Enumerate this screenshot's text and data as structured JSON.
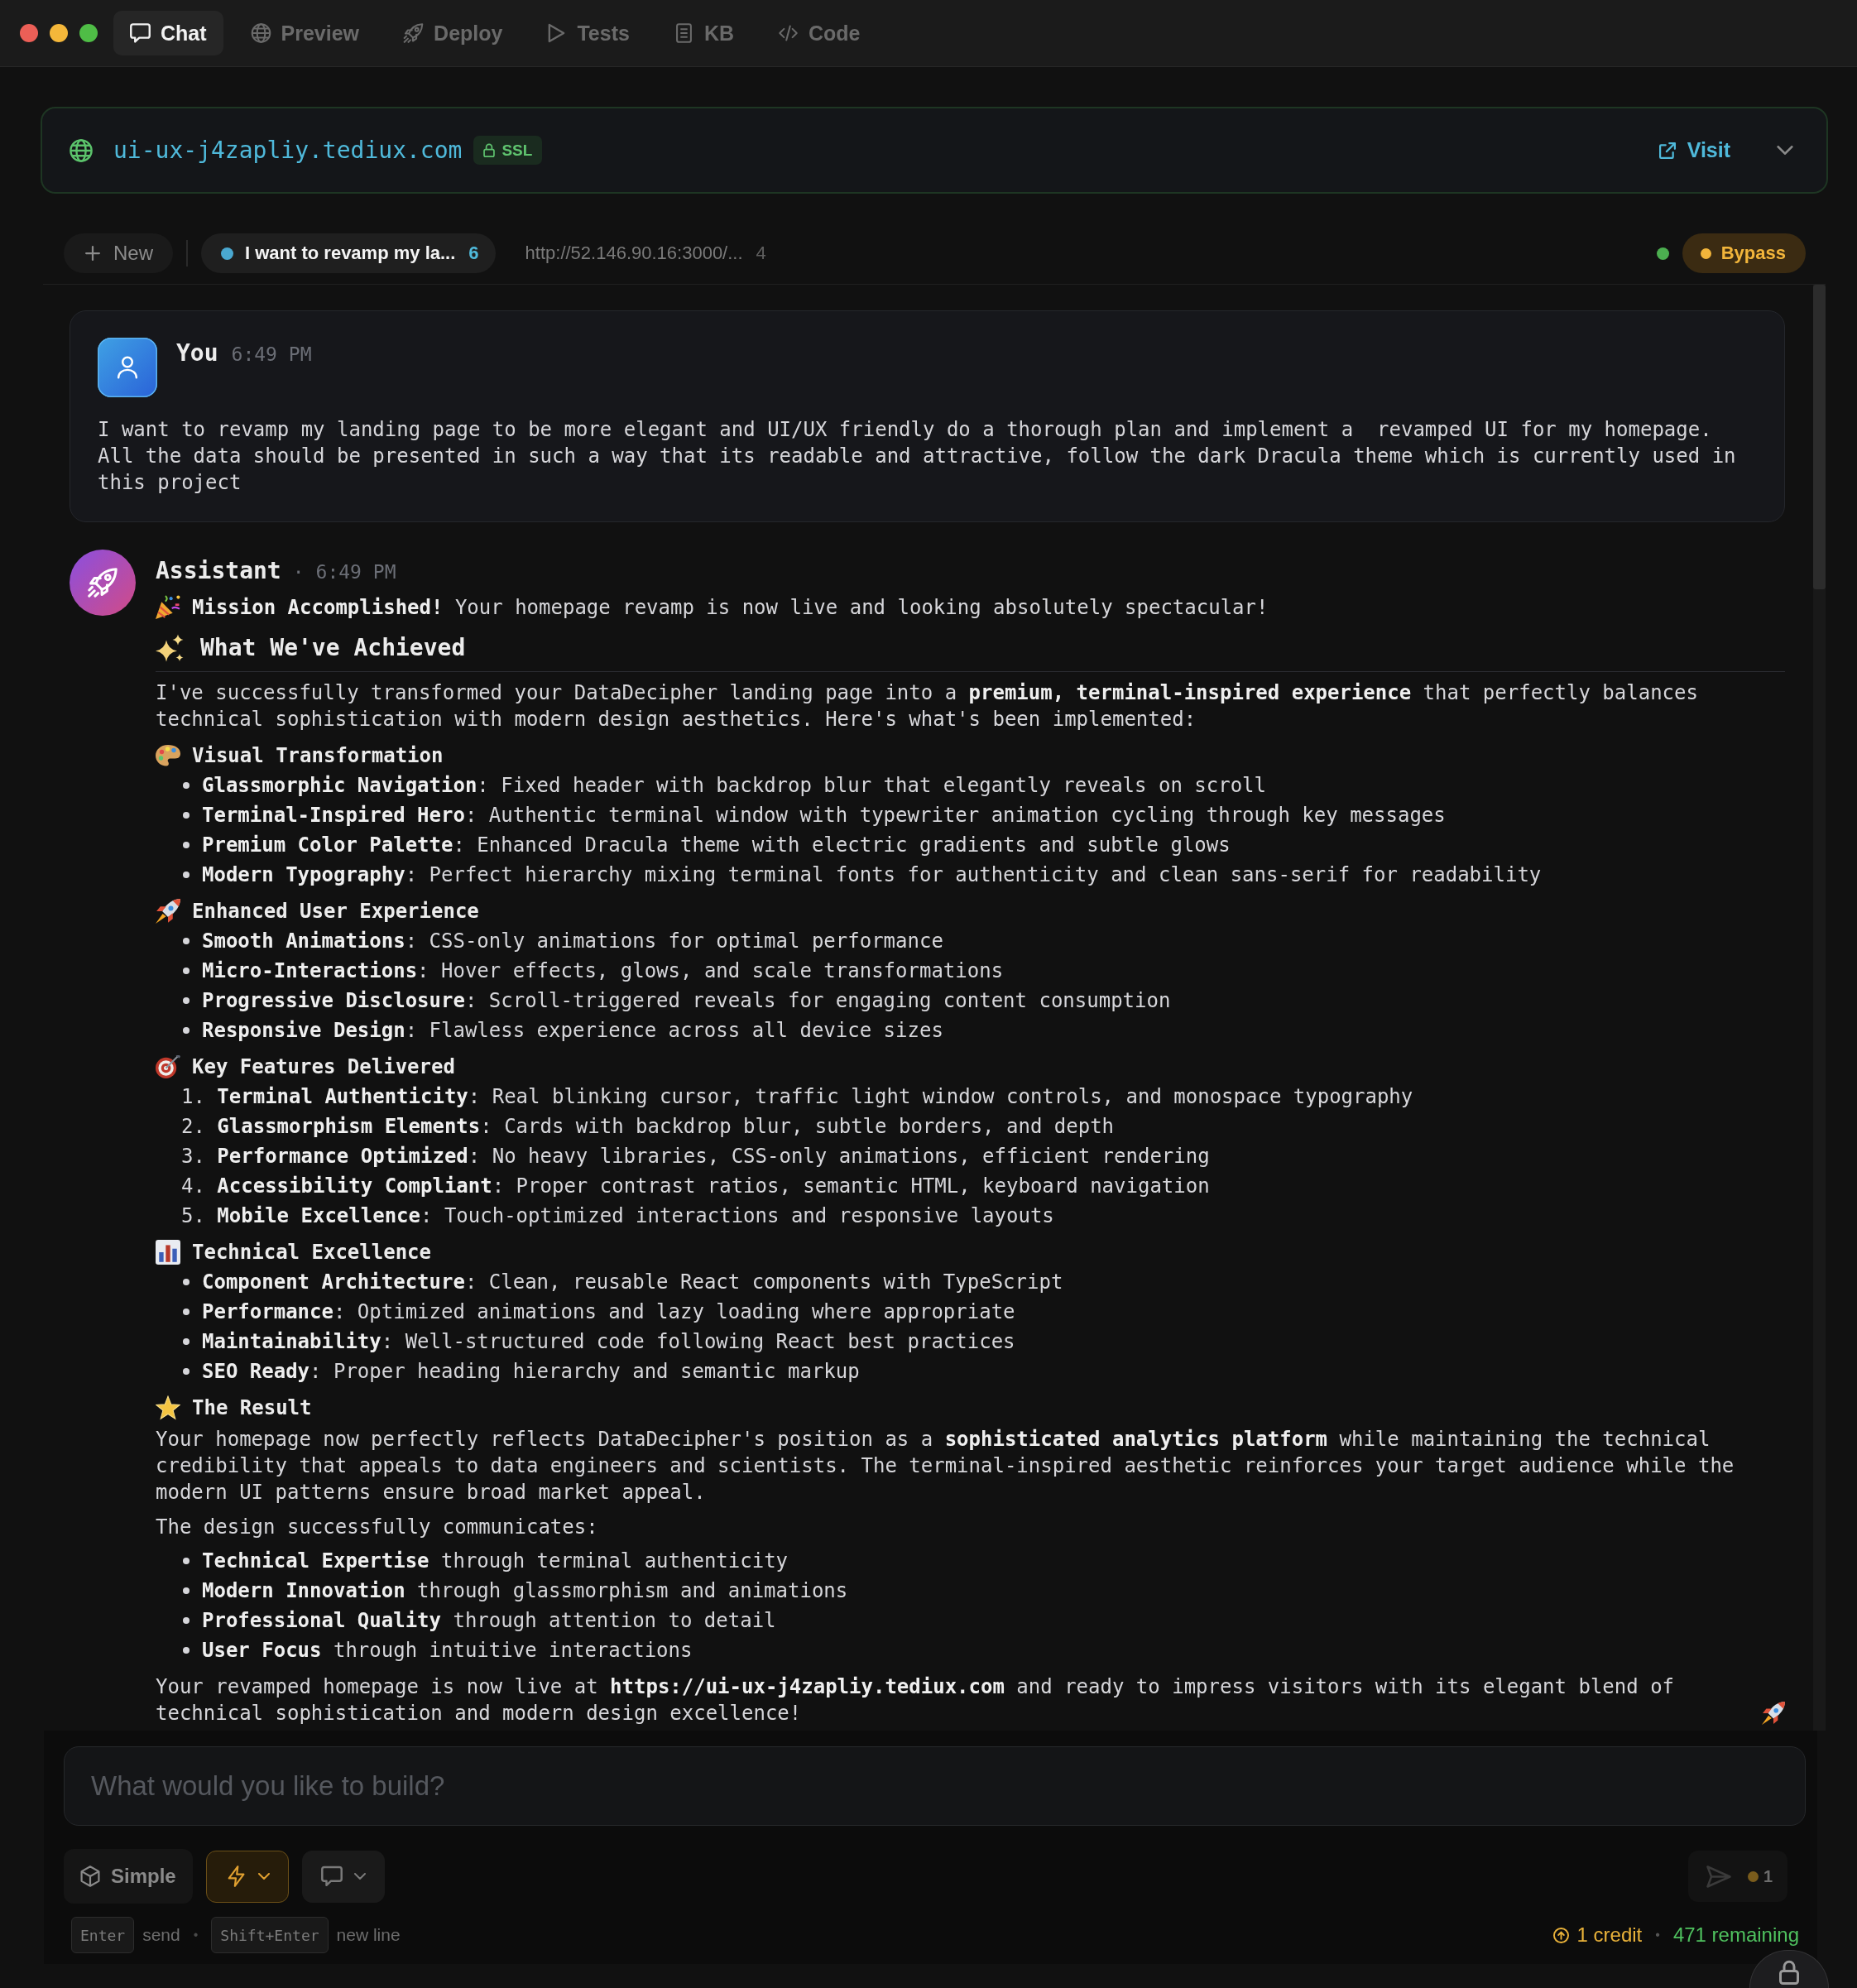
{
  "window": {
    "tabs": [
      {
        "label": "Chat",
        "selected": true
      },
      {
        "label": "Preview",
        "selected": false
      },
      {
        "label": "Deploy",
        "selected": false
      },
      {
        "label": "Tests",
        "selected": false
      },
      {
        "label": "KB",
        "selected": false
      },
      {
        "label": "Code",
        "selected": false
      }
    ]
  },
  "site": {
    "domain": "ui-ux-j4zapliy.tediux.com",
    "badge": "SSL",
    "visit": "Visit"
  },
  "sessions": {
    "new": "New",
    "items": [
      {
        "title": "I want to revamp my la...",
        "count": "6",
        "selected": true
      },
      {
        "title": "http://52.146.90.16:3000/...",
        "count": "4",
        "selected": false
      }
    ],
    "bypass": {
      "label": "Bypass",
      "on": true
    }
  },
  "messages": [
    {
      "kind": "user",
      "author": "You",
      "time": "6:49 PM",
      "text": "I want to revamp my landing page to be more elegant and UI/UX friendly do a thorough plan and implement a  revamped UI for my homepage. All the data should be presented in such a way that its readable and attractive, follow the dark Dracula theme which is currently used in this project"
    },
    {
      "kind": "assistant",
      "author": "Assistant",
      "separator": "·",
      "time": "6:49 PM",
      "blocks": [
        {
          "kind": "lead",
          "text": "**Mission Accomplished!** Your homepage revamp is now live and looking absolutely spectacular!"
        },
        {
          "kind": "heading",
          "text": "What We've Achieved"
        },
        {
          "kind": "paragraph",
          "text": "I've successfully transformed your DataDecipher landing page into a **premium, terminal-inspired experience** that perfectly balances technical sophistication with modern design aesthetics. Here's what's been implemented:"
        },
        {
          "kind": "title",
          "text": "Visual Transformation"
        },
        {
          "kind": "bullets",
          "items": [
            "**Glassmorphic Navigation**: Fixed header with backdrop blur that elegantly reveals on scroll",
            "**Terminal-Inspired Hero**: Authentic terminal window with typewriter animation cycling through key messages",
            "**Premium Color Palette**: Enhanced Dracula theme with electric gradients and subtle glows",
            "**Modern Typography**: Perfect hierarchy mixing terminal fonts for authenticity and clean sans-serif for readability"
          ]
        },
        {
          "kind": "title",
          "text": "Enhanced User Experience"
        },
        {
          "kind": "bullets",
          "items": [
            "**Smooth Animations**: CSS-only animations for optimal performance",
            "**Micro-Interactions**: Hover effects, glows, and scale transformations",
            "**Progressive Disclosure**: Scroll-triggered reveals for engaging content consumption",
            "**Responsive Design**: Flawless experience across all device sizes"
          ]
        },
        {
          "kind": "title",
          "text": "Key Features Delivered"
        },
        {
          "kind": "numbered",
          "items": [
            {
              "number": "1.",
              "text": "**Terminal Authenticity**: Real blinking cursor, traffic light window controls, and monospace typography"
            },
            {
              "number": "2.",
              "text": "**Glassmorphism Elements**: Cards with backdrop blur, subtle borders, and depth"
            },
            {
              "number": "3.",
              "text": "**Performance Optimized**: No heavy libraries, CSS-only animations, efficient rendering"
            },
            {
              "number": "4.",
              "text": "**Accessibility Compliant**: Proper contrast ratios, semantic HTML, keyboard navigation"
            },
            {
              "number": "5.",
              "text": "**Mobile Excellence**: Touch-optimized interactions and responsive layouts"
            }
          ]
        },
        {
          "kind": "title",
          "text": "Technical Excellence"
        },
        {
          "kind": "bullets",
          "items": [
            "**Component Architecture**: Clean, reusable React components with TypeScript",
            "**Performance**: Optimized animations and lazy loading where appropriate",
            "**Maintainability**: Well-structured code following React best practices",
            "**SEO Ready**: Proper heading hierarchy and semantic markup"
          ]
        },
        {
          "kind": "title",
          "text": "The Result"
        },
        {
          "kind": "paragraph",
          "text": "Your homepage now perfectly reflects DataDecipher's position as a **sophisticated analytics platform** while maintaining the technical credibility that appeals to data engineers and scientists. The terminal-inspired aesthetic reinforces your target audience while the modern UI patterns ensure broad market appeal."
        },
        {
          "kind": "paragraph",
          "text": "The design successfully communicates:"
        },
        {
          "kind": "bullets",
          "items": [
            "**Technical Expertise** through terminal authenticity",
            "**Modern Innovation** through glassmorphism and animations",
            "**Professional Quality** through attention to detail",
            "**User Focus** through intuitive interactions"
          ]
        },
        {
          "kind": "paragraph",
          "text": "Your revamped homepage is now live at **https://ui-ux-j4zapliy.tediux.com** and ready to impress visitors with its elegant blend of technical sophistication and modern design excellence!"
        }
      ]
    }
  ],
  "composer": {
    "placeholder": "What would you like to build?",
    "tools": [
      {
        "kind": "mode",
        "label": "Simple"
      },
      {
        "kind": "menu",
        "active": true
      },
      {
        "kind": "menu",
        "active": false
      }
    ],
    "send": {
      "disabled": true
    },
    "queue": "1",
    "hints": [
      {
        "key": "Enter",
        "action": "send"
      },
      {
        "key": "Shift+Enter",
        "action": "new line"
      }
    ],
    "hint_separator": "•",
    "credits": {
      "cost": "1 credit",
      "separator": "•",
      "remaining": "471 remaining"
    }
  }
}
